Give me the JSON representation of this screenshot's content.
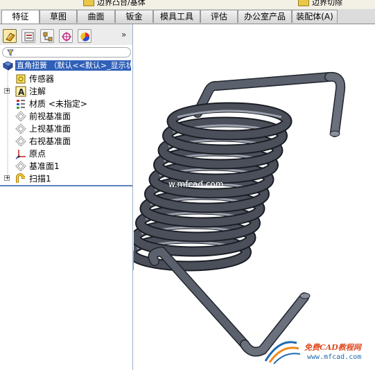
{
  "toolbar_strip": {
    "item1": "边界凸台/基体",
    "item2": "边界切除"
  },
  "tabs": [
    "特征",
    "草图",
    "曲面",
    "钣金",
    "模具工具",
    "评估",
    "办公室产品",
    "装配体(A)"
  ],
  "active_tab": "特征",
  "panel": {
    "more": "»",
    "tree_root": "直角扭簧 （默认<<默认>_显示状",
    "items": [
      {
        "label": "传感器",
        "icon": "sensor-icon",
        "expandable": false
      },
      {
        "label": "注解",
        "icon": "annotation-icon",
        "expandable": true
      },
      {
        "label": "材质 <未指定>",
        "icon": "material-icon",
        "expandable": false
      },
      {
        "label": "前视基准面",
        "icon": "plane-icon",
        "expandable": false
      },
      {
        "label": "上视基准面",
        "icon": "plane-icon",
        "expandable": false
      },
      {
        "label": "右视基准面",
        "icon": "plane-icon",
        "expandable": false
      },
      {
        "label": "原点",
        "icon": "origin-icon",
        "expandable": false
      },
      {
        "label": "基准面1",
        "icon": "plane-icon",
        "expandable": false
      },
      {
        "label": "扫描1",
        "icon": "sweep-icon",
        "expandable": true
      }
    ]
  },
  "viewport": {
    "watermark": "w.mfcad.com",
    "logo_name": "免费CAD教程网",
    "logo_url": "www.mfcad.com"
  },
  "colors": {
    "spring": "#4a4f5a",
    "selection": "#3060b8",
    "tree_separator": "#5a82c0"
  }
}
